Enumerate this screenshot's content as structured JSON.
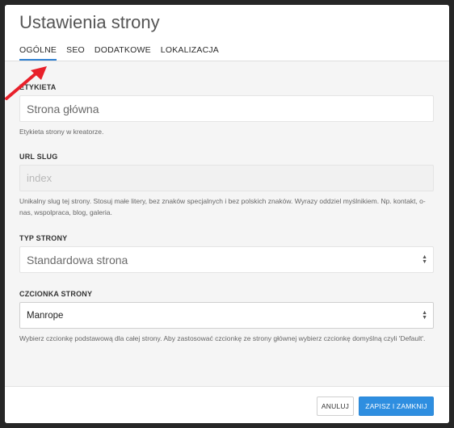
{
  "dialog": {
    "title": "Ustawienia strony",
    "tabs": [
      {
        "label": "OGÓLNE",
        "active": true
      },
      {
        "label": "SEO",
        "active": false
      },
      {
        "label": "DODATKOWE",
        "active": false
      },
      {
        "label": "LOKALIZACJA",
        "active": false
      }
    ]
  },
  "form": {
    "label_field": {
      "label": "ETYKIETA",
      "value": "Strona główna",
      "help": "Etykieta strony w kreatorze."
    },
    "slug_field": {
      "label": "URL SLUG",
      "placeholder": "index",
      "help": "Unikalny slug tej strony. Stosuj małe litery, bez znaków specjalnych i bez polskich znaków. Wyrazy oddziel myślnikiem. Np. kontakt, o-nas, wspolpraca, blog, galeria."
    },
    "type_field": {
      "label": "TYP STRONY",
      "selected": "Standardowa strona"
    },
    "font_field": {
      "label": "CZCIONKA STRONY",
      "selected": "Manrope",
      "help": "Wybierz czcionkę podstawową dla całej strony. Aby zastosować czcionkę ze strony głównej wybierz czcionkę domyślną czyli 'Default'."
    }
  },
  "footer": {
    "cancel_label": "ANULUJ",
    "save_label": "ZAPISZ I ZAMKNIJ"
  },
  "colors": {
    "accent": "#2e8ee0",
    "annotation_arrow": "#e8202a"
  }
}
